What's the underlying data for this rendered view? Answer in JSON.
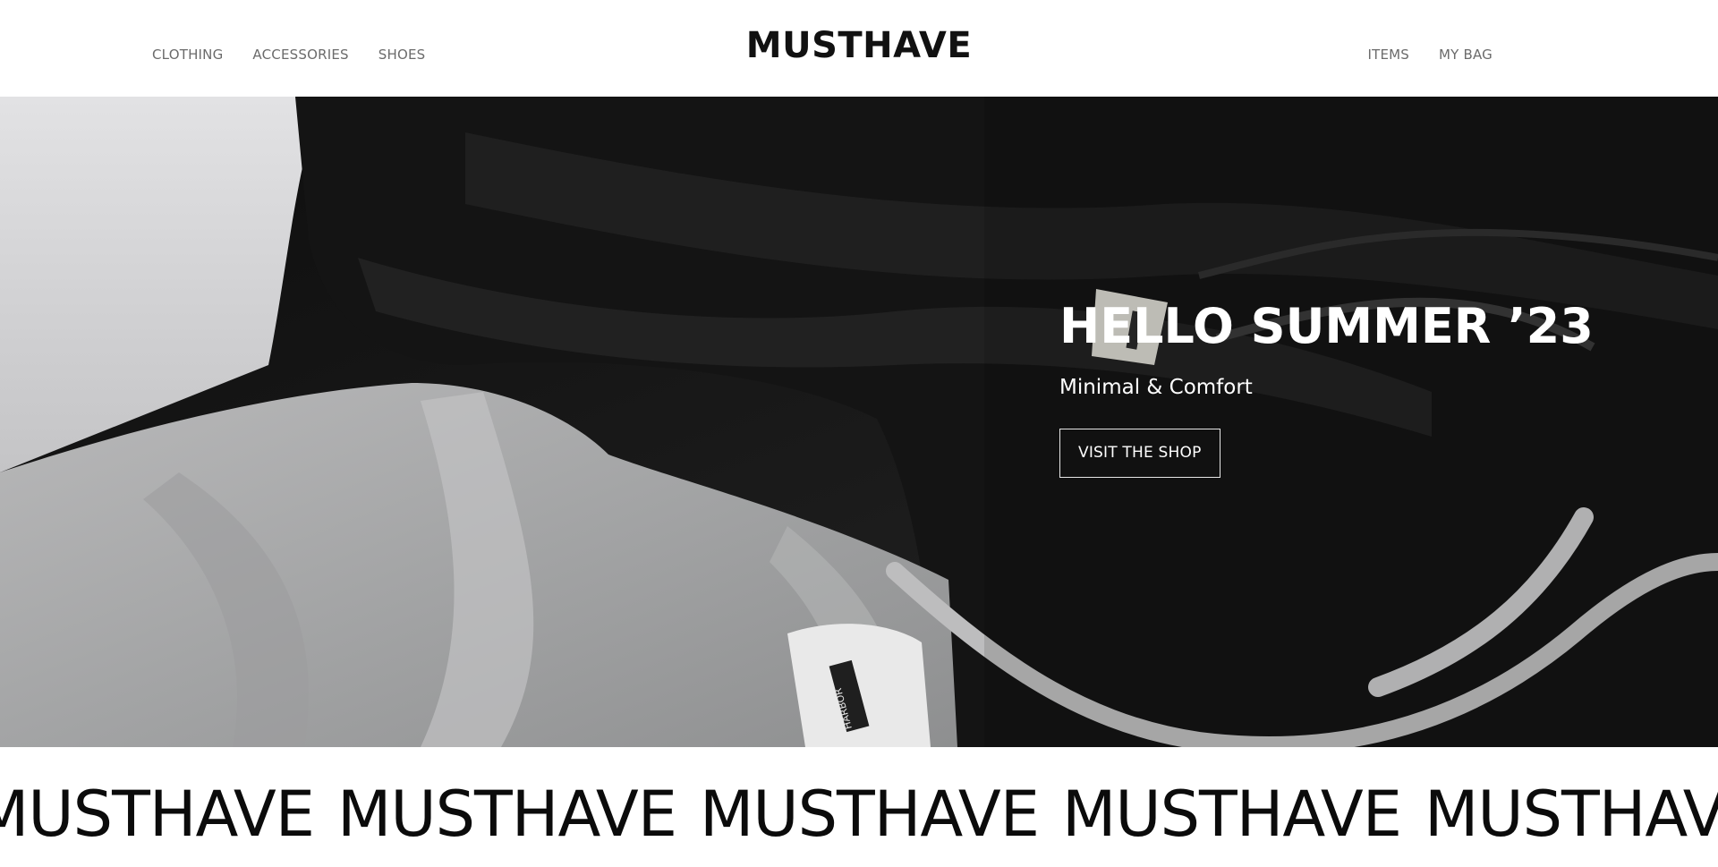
{
  "header": {
    "logo": "MUSTHAVE",
    "nav_left": [
      {
        "label": "CLOTHING"
      },
      {
        "label": "ACCESSORIES"
      },
      {
        "label": "SHOES"
      }
    ],
    "nav_right": [
      {
        "label": "ITEMS"
      },
      {
        "label": "MY BAG"
      }
    ]
  },
  "hero": {
    "title": "HELLO SUMMER ’23",
    "subtitle": "Minimal & Comfort",
    "cta_label": "VISIT THE SHOP",
    "tag_text": "HARBOR"
  },
  "marquee": {
    "words": [
      "MUSTHAVE",
      "MUSTHAVE",
      "MUSTHAVE",
      "MUSTHAVE",
      "MUSTHAVE"
    ]
  }
}
